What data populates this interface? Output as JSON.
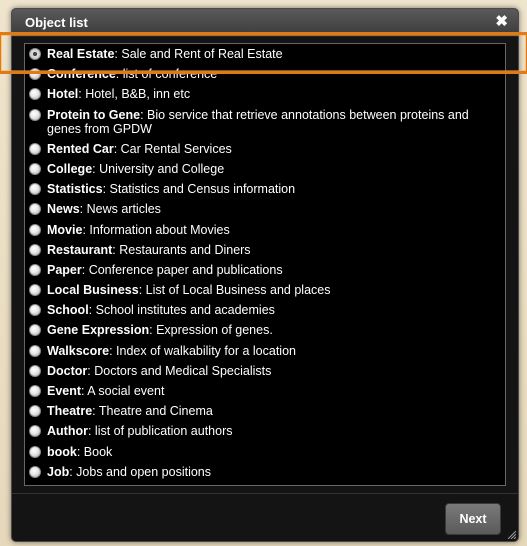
{
  "dialog": {
    "title": "Object list",
    "close_glyph": "✖",
    "next_label": "Next"
  },
  "items": [
    {
      "name": "Real Estate",
      "desc": ": Sale and Rent of Real Estate",
      "selected": true
    },
    {
      "name": "Conference",
      "desc": ": list of conference",
      "selected": false
    },
    {
      "name": "Hotel",
      "desc": ": Hotel, B&B, inn etc",
      "selected": false
    },
    {
      "name": "Protein to Gene",
      "desc": ": Bio service that retrieve annotations between proteins and genes from GPDW",
      "selected": false
    },
    {
      "name": "Rented Car",
      "desc": ": Car Rental Services",
      "selected": false
    },
    {
      "name": "College",
      "desc": ": University and College",
      "selected": false
    },
    {
      "name": "Statistics",
      "desc": ": Statistics and Census information",
      "selected": false
    },
    {
      "name": "News",
      "desc": ": News articles",
      "selected": false
    },
    {
      "name": "Movie",
      "desc": ": Information about Movies",
      "selected": false
    },
    {
      "name": "Restaurant",
      "desc": ": Restaurants and Diners",
      "selected": false
    },
    {
      "name": "Paper",
      "desc": ": Conference paper and publications",
      "selected": false
    },
    {
      "name": "Local Business",
      "desc": ": List of Local Business and places",
      "selected": false
    },
    {
      "name": "School",
      "desc": ": School institutes and academies",
      "selected": false
    },
    {
      "name": "Gene Expression",
      "desc": ": Expression of genes.",
      "selected": false
    },
    {
      "name": "Walkscore",
      "desc": ": Index of walkability for a location",
      "selected": false
    },
    {
      "name": "Doctor",
      "desc": ": Doctors and Medical Specialists",
      "selected": false
    },
    {
      "name": "Event",
      "desc": ": A social event",
      "selected": false
    },
    {
      "name": "Theatre",
      "desc": ": Theatre and Cinema",
      "selected": false
    },
    {
      "name": "Author",
      "desc": ": list of publication authors",
      "selected": false
    },
    {
      "name": "book",
      "desc": ": Book",
      "selected": false
    },
    {
      "name": "Job",
      "desc": ": Jobs and open positions",
      "selected": false
    }
  ],
  "colors": {
    "highlight": "#e07a16",
    "dialog_bg": "#141414",
    "titlebar": "#4a4a4a"
  }
}
